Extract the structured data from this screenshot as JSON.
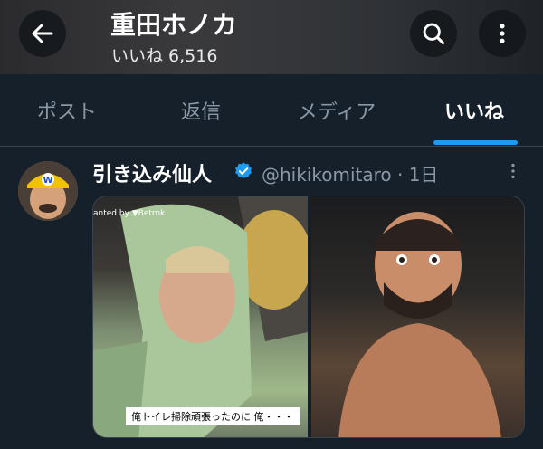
{
  "header": {
    "title": "重田ホノカ",
    "subtitle": "いいね 6,516",
    "back_icon": "arrow-left-icon",
    "search_icon": "search-icon",
    "more_icon": "more-vertical-icon"
  },
  "tabs": [
    {
      "label": "ポスト",
      "active": false
    },
    {
      "label": "返信",
      "active": false
    },
    {
      "label": "メディア",
      "active": false
    },
    {
      "label": "いいね",
      "active": true
    }
  ],
  "tweet": {
    "author": "引き込み仙人",
    "handle_time": "@hikikomitaro · 1日",
    "verified": true,
    "media": [
      {
        "watermark": "anted by ▼Betrnk",
        "caption": "俺トイレ掃除頑張ったのに 俺・・・"
      },
      {}
    ]
  },
  "colors": {
    "accent": "#1d9bf0",
    "background": "#15202b",
    "muted_text": "#8b98a5"
  }
}
